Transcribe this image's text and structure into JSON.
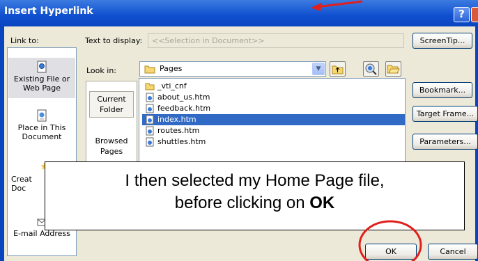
{
  "window": {
    "title": "Insert Hyperlink",
    "help_label": "?"
  },
  "link_to": {
    "label": "Link to:",
    "items": [
      {
        "label": "Existing File or Web Page",
        "lines": [
          "Existing File or",
          "Web Page"
        ],
        "selected": true
      },
      {
        "label": "Place in This Document",
        "lines": [
          "Place in This",
          "Document"
        ],
        "selected": false
      },
      {
        "label": "Create New Document",
        "lines": [
          "Creat",
          "Doc"
        ],
        "selected": false
      },
      {
        "label": "E-mail Address",
        "lines": [
          "E-mail Address"
        ],
        "selected": false
      }
    ]
  },
  "text_to_display": {
    "label": "Text to display:",
    "value": "<<Selection in Document>>"
  },
  "look_in": {
    "label": "Look in:",
    "value": "Pages"
  },
  "side_tabs": [
    {
      "lines": [
        "Current",
        "Folder"
      ],
      "selected": true
    },
    {
      "lines": [
        "Browsed",
        "Pages"
      ],
      "selected": false
    }
  ],
  "files": [
    {
      "name": "_vti_cnf",
      "type": "folder",
      "selected": false
    },
    {
      "name": "about_us.htm",
      "type": "file",
      "selected": false
    },
    {
      "name": "feedback.htm",
      "type": "file",
      "selected": false
    },
    {
      "name": "index.htm",
      "type": "file",
      "selected": true
    },
    {
      "name": "routes.htm",
      "type": "file",
      "selected": false
    },
    {
      "name": "shuttles.htm",
      "type": "file",
      "selected": false
    }
  ],
  "buttons": {
    "screentip": "ScreenTip...",
    "bookmark": "Bookmark...",
    "target_frame": "Target Frame...",
    "parameters": "Parameters...",
    "ok": "OK",
    "cancel": "Cancel"
  },
  "annotation": {
    "line1": "I then selected my Home Page file,",
    "line2_prefix": "before clicking on ",
    "line2_bold": "OK"
  },
  "colors": {
    "title_bar": "#0f4fcf",
    "selection": "#316ac5",
    "annotation_red": "#e0201c"
  }
}
